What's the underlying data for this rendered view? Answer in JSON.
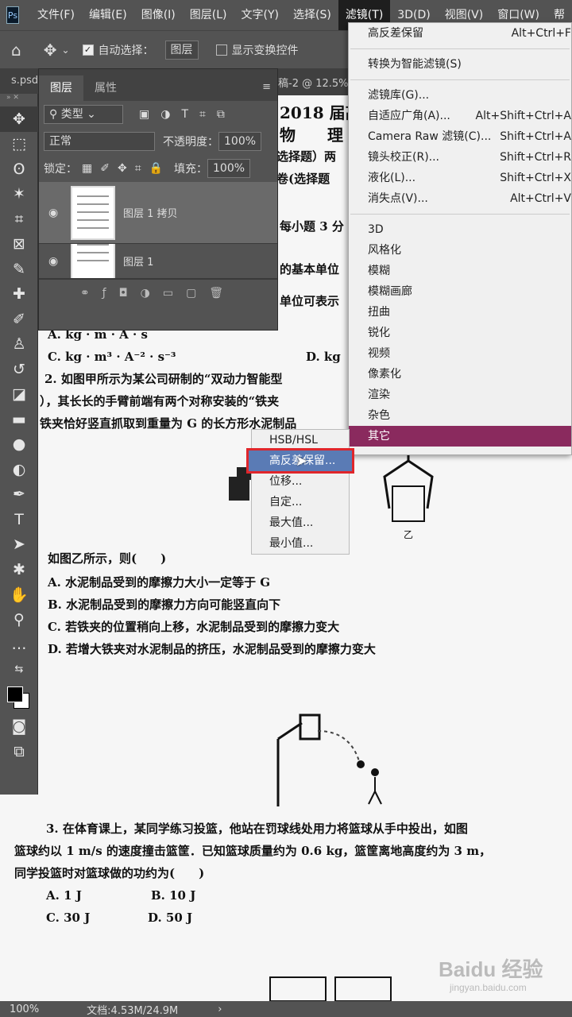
{
  "app_logo": "Ps",
  "menubar": [
    "文件(F)",
    "编辑(E)",
    "图像(I)",
    "图层(L)",
    "文字(Y)",
    "选择(S)",
    "滤镜(T)",
    "3D(D)",
    "视图(V)",
    "窗口(W)",
    "帮"
  ],
  "options": {
    "auto_select_label": "自动选择：",
    "auto_select_target": "图层",
    "show_transform_label": "显示变换控件"
  },
  "doc_tab": {
    "name": "s.psd",
    "partial_title": "稿-2 @ 12.5%"
  },
  "layers_panel": {
    "tabs": [
      "图层",
      "属性"
    ],
    "filter_kind": "类型",
    "blend_mode": "正常",
    "opacity_label": "不透明度：",
    "opacity": "100%",
    "lock_label": "锁定：",
    "fill_label": "填充：",
    "fill": "100%",
    "layers": [
      {
        "name": "图层 1 拷贝"
      },
      {
        "name": "图层 1"
      }
    ]
  },
  "filter_menu": {
    "items": [
      {
        "label": "高反差保留",
        "shortcut": "Alt+Ctrl+F"
      },
      {
        "label": "转换为智能滤镜(S)",
        "shortcut": ""
      },
      {
        "label": "滤镜库(G)...",
        "shortcut": ""
      },
      {
        "label": "自适应广角(A)...",
        "shortcut": "Alt+Shift+Ctrl+A"
      },
      {
        "label": "Camera Raw 滤镜(C)...",
        "shortcut": "Shift+Ctrl+A"
      },
      {
        "label": "镜头校正(R)...",
        "shortcut": "Shift+Ctrl+R"
      },
      {
        "label": "液化(L)...",
        "shortcut": "Shift+Ctrl+X"
      },
      {
        "label": "消失点(V)...",
        "shortcut": "Alt+Ctrl+V"
      },
      {
        "label": "3D",
        "shortcut": ""
      },
      {
        "label": "风格化",
        "shortcut": ""
      },
      {
        "label": "模糊",
        "shortcut": ""
      },
      {
        "label": "模糊画廊",
        "shortcut": ""
      },
      {
        "label": "扭曲",
        "shortcut": ""
      },
      {
        "label": "锐化",
        "shortcut": ""
      },
      {
        "label": "视频",
        "shortcut": ""
      },
      {
        "label": "像素化",
        "shortcut": ""
      },
      {
        "label": "渲染",
        "shortcut": ""
      },
      {
        "label": "杂色",
        "shortcut": ""
      },
      {
        "label": "其它",
        "shortcut": ""
      }
    ]
  },
  "other_submenu": [
    "HSB/HSL",
    "高反差保留...",
    "位移...",
    "自定...",
    "最大值...",
    "最小值..."
  ],
  "document_text": {
    "l1": "2018 届高",
    "l2": "物　　理 2",
    "l3": "选择题）两",
    "l4": "卷(选择题",
    "l5": "每小题 3 分",
    "l6": "的基本单位",
    "l7": "单位可表示",
    "l8": "A.  kg · m · A · s",
    "l9c": "C.   kg · m³ · A⁻² · s⁻³",
    "l9d": "D.   kg",
    "q2a": "2. 如图甲所示为某公司研制的“双动力智能型",
    "q2b": "），其长长的手臂前端有两个对称安装的“铁夹",
    "q2c": "铁夹恰好竖直抓取到重量为 G 的长方形水泥制品",
    "fig_z": "乙",
    "q2d": "如图乙所示，则(　　)",
    "q2A": "A. 水泥制品受到的摩擦力大小一定等于 G",
    "q2B": "B. 水泥制品受到的摩擦力方向可能竖直向下",
    "q2C": "C. 若铁夹的位置稍向上移，水泥制品受到的摩擦力变大",
    "q2D": "D. 若增大铁夹对水泥制品的挤压，水泥制品受到的摩擦力变大",
    "q3a": "3. 在体育课上，某同学练习投篮，他站在罚球线处用力将篮球从手中投出，如图",
    "q3b": "篮球约以 1 m/s 的速度撞击篮筐．已知篮球质量约为 0.6 kg，篮筐离地高度约为 3 m，",
    "q3c": "同学投篮时对篮球做的功约为(　　)",
    "q3A": "A.   1 J",
    "q3B": "B. 10 J",
    "q3C": "C. 30 J",
    "q3D": "D.   50 J"
  },
  "status": {
    "zoom": "100%",
    "doc": "文档:4.53M/24.9M"
  },
  "watermark": {
    "brand": "Baidu 经验",
    "url": "jingyan.baidu.com"
  },
  "colors": {
    "highlight": "#8a2a5e",
    "accent_red": "#e0262b",
    "ui_gray": "#535353"
  }
}
